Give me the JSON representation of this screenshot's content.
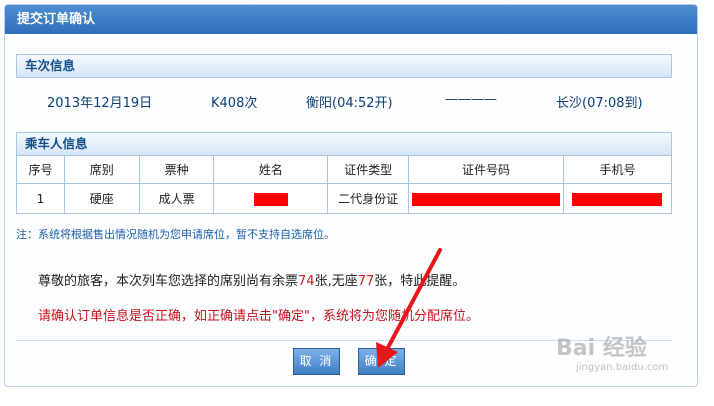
{
  "dialog": {
    "title": "提交订单确认"
  },
  "train_section": {
    "header": "车次信息",
    "date": "2013年12月19日",
    "train_no": "K408次",
    "departure": "衡阳(04:52开)",
    "separator": "————",
    "arrival": "长沙(07:08到)"
  },
  "passenger_section": {
    "header": "乘车人信息",
    "columns": [
      "序号",
      "席别",
      "票种",
      "姓名",
      "证件类型",
      "证件号码",
      "手机号"
    ],
    "rows": [
      {
        "index": "1",
        "seat_class": "硬座",
        "ticket_type": "成人票",
        "id_type": "二代身份证"
      }
    ]
  },
  "note": "注：系统将根据售出情况随机为您申请席位，暂不支持自选席位。",
  "availability": {
    "prefix": "尊敬的旅客，本次列车您选择的席别尚有余票",
    "seat_count": "74",
    "mid": "张,无座",
    "standing_count": "77",
    "suffix": "张，特此提醒。"
  },
  "confirm_message": "请确认订单信息是否正确，如正确请点击\"确定\"，系统将为您随机分配席位。",
  "buttons": {
    "cancel": "取 消",
    "ok": "确 定"
  },
  "watermark": {
    "logo": "Bai 经验",
    "url": "jingyan.baidu.com"
  },
  "colors": {
    "title_bar": "#3a7cc5",
    "accent_red": "#c8111c",
    "redaction": "#ff0000",
    "arrow": "#e8161b"
  }
}
